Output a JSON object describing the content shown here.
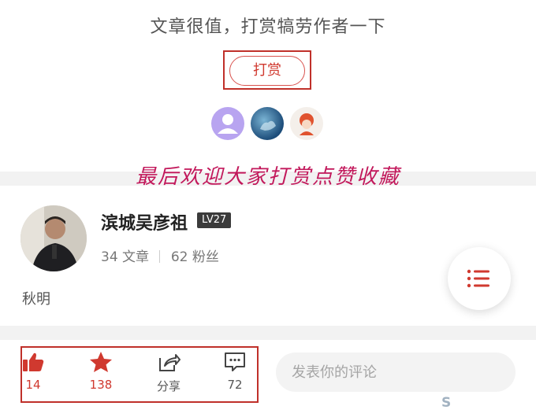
{
  "reward": {
    "prompt": "文章很值，打赏犒劳作者一下",
    "button_label": "打赏"
  },
  "promo_text": "最后欢迎大家打赏点赞收藏",
  "author": {
    "name": "滨城吴彦祖",
    "level": "LV27",
    "articles_count": "34",
    "articles_label": "文章",
    "fans_count": "62",
    "fans_label": "粉丝",
    "signature": "秋明"
  },
  "actions": {
    "like_count": "14",
    "favorite_count": "138",
    "share_label": "分享",
    "comment_count": "72"
  },
  "comment": {
    "placeholder": "发表你的评论"
  },
  "watermark": "S",
  "colors": {
    "accent": "#d0392f",
    "promo": "#c2185b",
    "highlight": "#c0302a"
  }
}
